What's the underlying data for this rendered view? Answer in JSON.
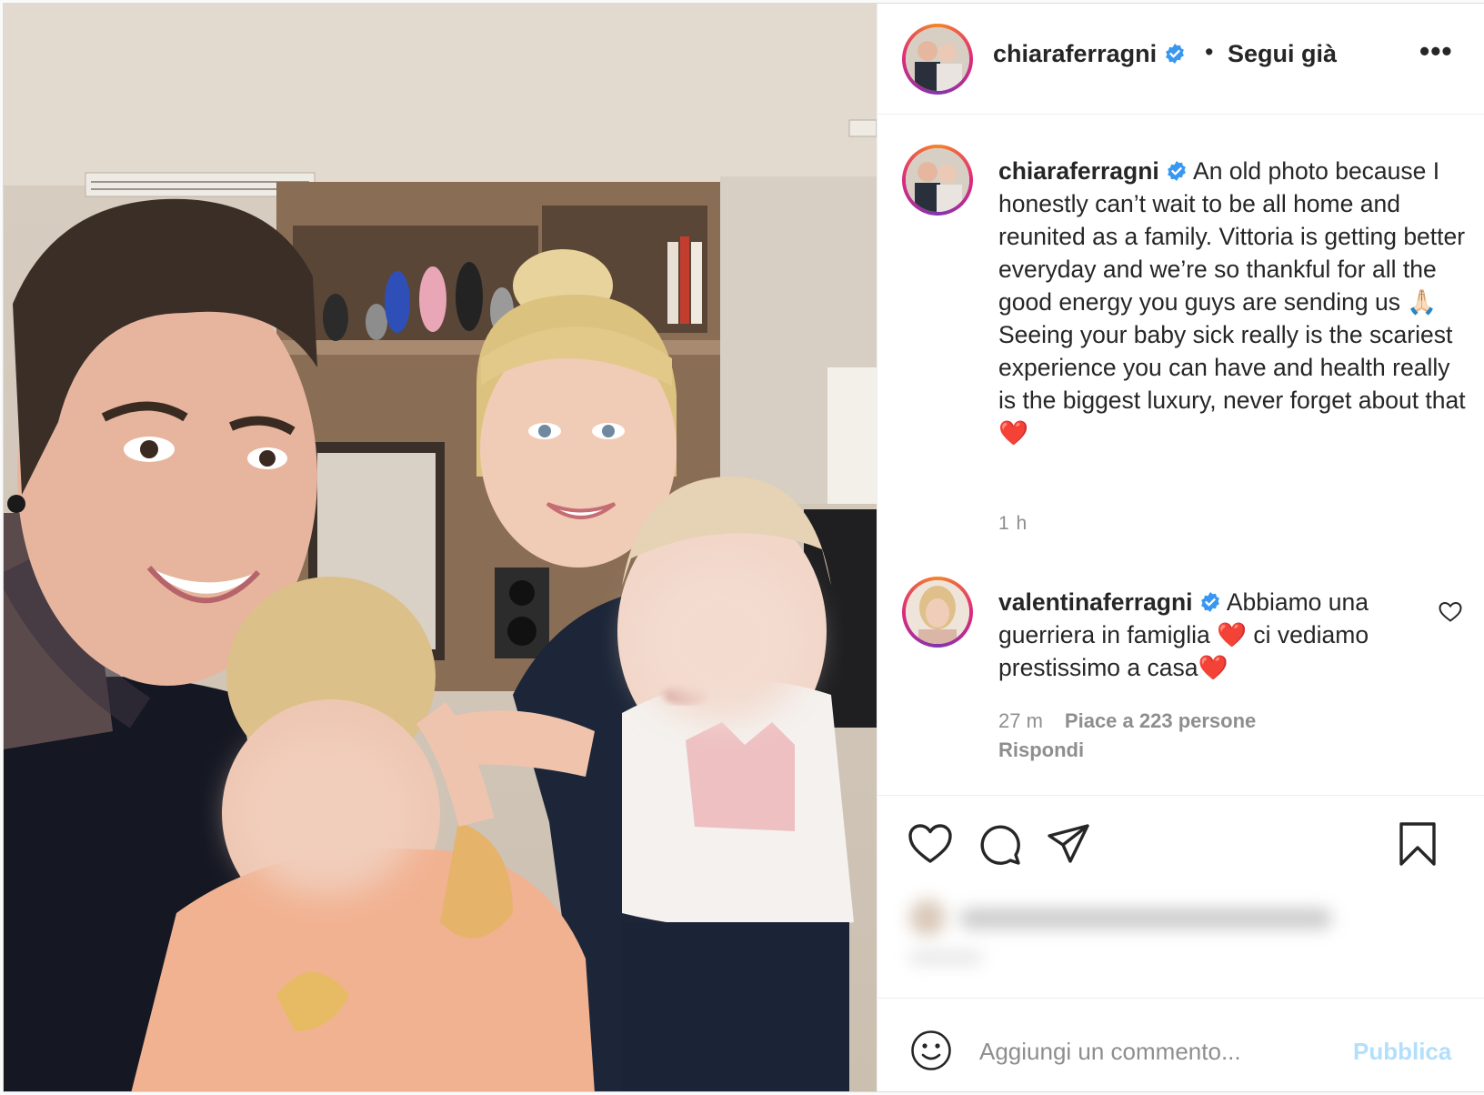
{
  "post": {
    "author": "chiaraferragni",
    "separator": "•",
    "follow_label": "Segui già",
    "more_label": "•••",
    "caption": "An old photo because I honestly can’t wait to be all home and reunited as a family. Vittoria is getting better everyday and we’re so thankful for all the good energy you guys are sending us 🙏🏻 Seeing your baby sick really is the scariest experience you can have and health really is the biggest luxury, never forget about that ❤️",
    "time": "1 h"
  },
  "comment": {
    "author": "valentinaferragni",
    "text": "Abbiamo una guerriera in famiglia ❤️ ci vediamo prestissimo a casa❤️",
    "time": "27 m",
    "likes": "Piace a 223 persone",
    "reply_label": "Rispondi"
  },
  "add_comment": {
    "placeholder": "Aggiungi un commento...",
    "publish_label": "Pubblica"
  },
  "colors": {
    "verified": "#3897f0",
    "heart": "#ed4956",
    "publish_disabled": "#b2dffc",
    "muted_text": "#8e8e8e"
  },
  "icons": [
    "verified-badge-icon",
    "more-options-icon",
    "like-icon",
    "comment-icon",
    "share-icon",
    "save-icon",
    "emoji-icon",
    "comment-like-icon"
  ]
}
